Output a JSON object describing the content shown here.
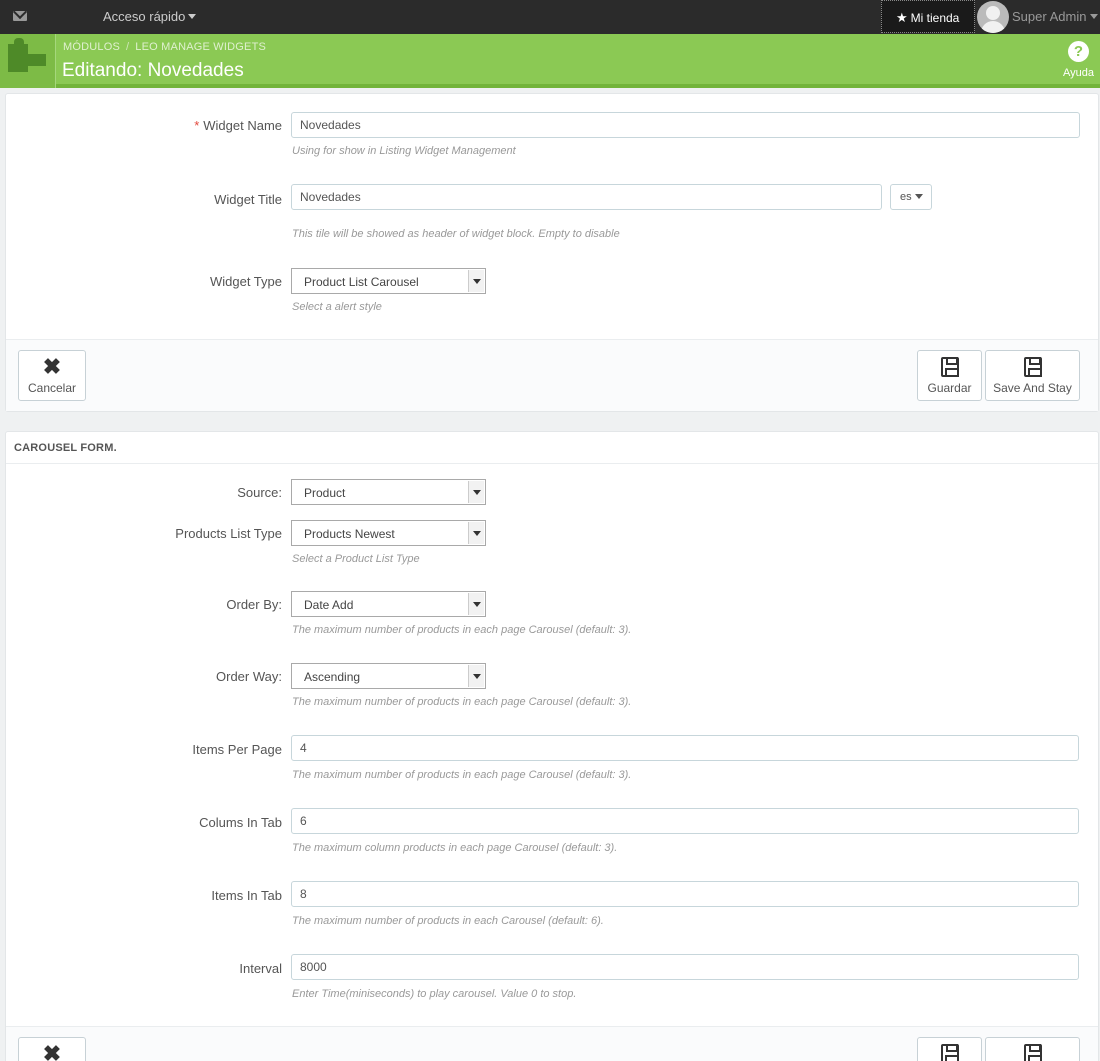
{
  "topbar": {
    "quick_access": "Acceso rápido",
    "store": "Mi tienda",
    "user": "Super Admin"
  },
  "header": {
    "breadcrumb": [
      "MÓDULOS",
      "LEO MANAGE WIDGETS"
    ],
    "title": "Editando: Novedades",
    "help": "Ayuda"
  },
  "general": {
    "widget_name": {
      "label": "Widget Name",
      "required": "*",
      "value": "Novedades",
      "help": "Using for show in Listing Widget Management"
    },
    "widget_title": {
      "label": "Widget Title",
      "value": "Novedades",
      "lang": "es",
      "help": "This tile will be showed as header of widget block. Empty to disable"
    },
    "widget_type": {
      "label": "Widget Type",
      "value": "Product List Carousel",
      "help": "Select a alert style"
    },
    "cancel": "Cancelar",
    "save": "Guardar",
    "save_stay": "Save And Stay"
  },
  "carousel": {
    "heading": "CAROUSEL FORM.",
    "source": {
      "label": "Source:",
      "value": "Product"
    },
    "list_type": {
      "label": "Products List Type",
      "value": "Products Newest",
      "help": "Select a Product List Type"
    },
    "order_by": {
      "label": "Order By:",
      "value": "Date Add",
      "help": "The maximum number of products in each page Carousel (default: 3)."
    },
    "order_way": {
      "label": "Order Way:",
      "value": "Ascending",
      "help": "The maximum number of products in each page Carousel (default: 3)."
    },
    "items_per_page": {
      "label": "Items Per Page",
      "value": "4",
      "help": "The maximum number of products in each page Carousel (default: 3)."
    },
    "colums_in_tab": {
      "label": "Colums In Tab",
      "value": "6",
      "help": "The maximum column products in each page Carousel (default: 3)."
    },
    "items_in_tab": {
      "label": "Items In Tab",
      "value": "8",
      "help": "The maximum number of products in each Carousel (default: 6)."
    },
    "interval": {
      "label": "Interval",
      "value": "8000",
      "help": "Enter Time(miniseconds) to play carousel. Value 0 to stop."
    }
  }
}
